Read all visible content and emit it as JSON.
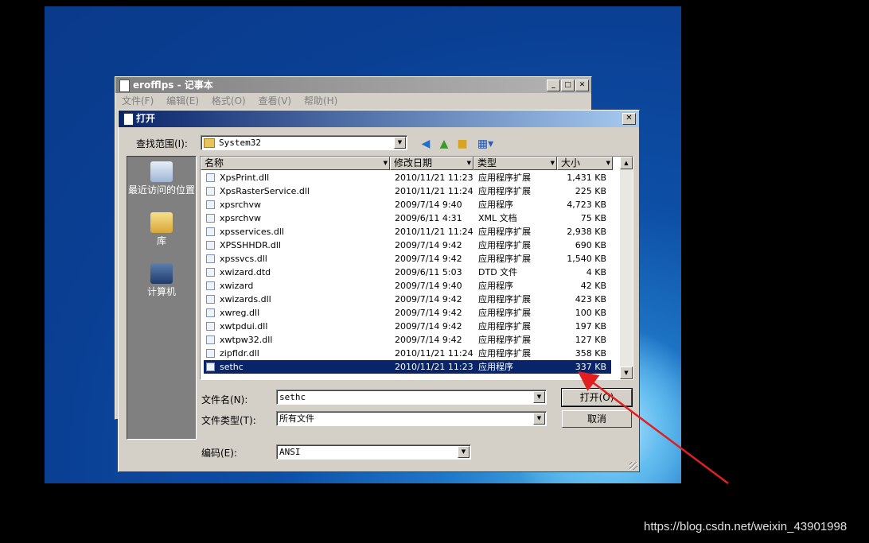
{
  "watermark": "https://blog.csdn.net/weixin_43901998",
  "notepad": {
    "title": "erofflps - 记事本",
    "menu": [
      "文件(F)",
      "编辑(E)",
      "格式(O)",
      "查看(V)",
      "帮助(H)"
    ]
  },
  "dialog": {
    "title": "打开",
    "lookin_label": "查找范围(I):",
    "lookin_value": "System32",
    "places": [
      "最近访问的位置",
      "库",
      "计算机"
    ],
    "columns": [
      "名称",
      "修改日期",
      "类型",
      "大小"
    ],
    "files": [
      {
        "name": "XpsPrint.dll",
        "date": "2010/11/21 11:23",
        "type": "应用程序扩展",
        "size": "1,431 KB"
      },
      {
        "name": "XpsRasterService.dll",
        "date": "2010/11/21 11:24",
        "type": "应用程序扩展",
        "size": "225 KB"
      },
      {
        "name": "xpsrchvw",
        "date": "2009/7/14 9:40",
        "type": "应用程序",
        "size": "4,723 KB"
      },
      {
        "name": "xpsrchvw",
        "date": "2009/6/11 4:31",
        "type": "XML 文档",
        "size": "75 KB"
      },
      {
        "name": "xpsservices.dll",
        "date": "2010/11/21 11:24",
        "type": "应用程序扩展",
        "size": "2,938 KB"
      },
      {
        "name": "XPSSHHDR.dll",
        "date": "2009/7/14 9:42",
        "type": "应用程序扩展",
        "size": "690 KB"
      },
      {
        "name": "xpssvcs.dll",
        "date": "2009/7/14 9:42",
        "type": "应用程序扩展",
        "size": "1,540 KB"
      },
      {
        "name": "xwizard.dtd",
        "date": "2009/6/11 5:03",
        "type": "DTD 文件",
        "size": "4 KB"
      },
      {
        "name": "xwizard",
        "date": "2009/7/14 9:40",
        "type": "应用程序",
        "size": "42 KB"
      },
      {
        "name": "xwizards.dll",
        "date": "2009/7/14 9:42",
        "type": "应用程序扩展",
        "size": "423 KB"
      },
      {
        "name": "xwreg.dll",
        "date": "2009/7/14 9:42",
        "type": "应用程序扩展",
        "size": "100 KB"
      },
      {
        "name": "xwtpdui.dll",
        "date": "2009/7/14 9:42",
        "type": "应用程序扩展",
        "size": "197 KB"
      },
      {
        "name": "xwtpw32.dll",
        "date": "2009/7/14 9:42",
        "type": "应用程序扩展",
        "size": "127 KB"
      },
      {
        "name": "zipfldr.dll",
        "date": "2010/11/21 11:24",
        "type": "应用程序扩展",
        "size": "358 KB"
      },
      {
        "name": "sethc",
        "date": "2010/11/21 11:23",
        "type": "应用程序",
        "size": "337 KB"
      }
    ],
    "filename_label": "文件名(N):",
    "filename_value": "sethc",
    "filetype_label": "文件类型(T):",
    "filetype_value": "所有文件",
    "encoding_label": "编码(E):",
    "encoding_value": "ANSI",
    "open_button": "打开(O)",
    "cancel_button": "取消"
  },
  "colors": {
    "selection": "#0a246a",
    "arrow": "#e02020"
  }
}
